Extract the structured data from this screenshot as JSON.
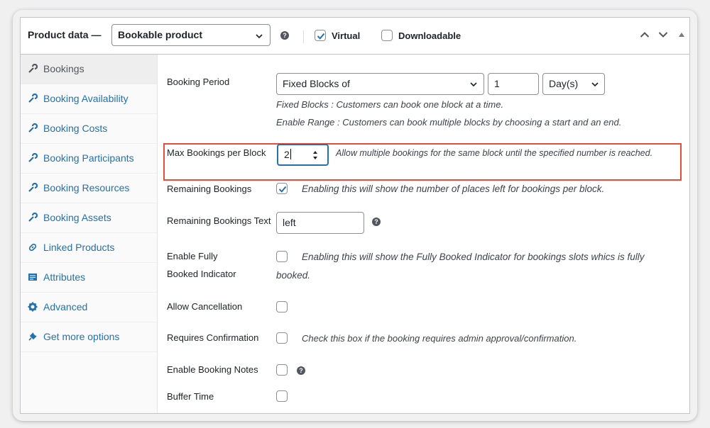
{
  "header": {
    "title": "Product data —",
    "product_type": "Bookable product",
    "virtual_label": "Virtual",
    "virtual_checked": true,
    "downloadable_label": "Downloadable",
    "downloadable_checked": false
  },
  "sidebar": {
    "items": [
      {
        "label": "Bookings",
        "icon": "wrench-icon",
        "active": true
      },
      {
        "label": "Booking Availability",
        "icon": "wrench-icon"
      },
      {
        "label": "Booking Costs",
        "icon": "wrench-icon"
      },
      {
        "label": "Booking Participants",
        "icon": "wrench-icon"
      },
      {
        "label": "Booking Resources",
        "icon": "wrench-icon"
      },
      {
        "label": "Booking Assets",
        "icon": "wrench-icon"
      },
      {
        "label": "Linked Products",
        "icon": "link-icon"
      },
      {
        "label": "Attributes",
        "icon": "list-icon"
      },
      {
        "label": "Advanced",
        "icon": "gear-icon"
      },
      {
        "label": "Get more options",
        "icon": "plugin-icon"
      }
    ]
  },
  "fields": {
    "booking_period": {
      "label": "Booking Period",
      "type_value": "Fixed Blocks of",
      "count_value": "1",
      "unit_value": "Day(s)",
      "desc1": "Fixed Blocks : Customers can book one block at a time.",
      "desc2": "Enable Range : Customers can book multiple blocks by choosing a start and an end."
    },
    "max_bookings": {
      "label": "Max Bookings per Block",
      "value": "2",
      "desc": "Allow multiple bookings for the same block until the specified number is reached."
    },
    "remaining_bookings": {
      "label": "Remaining Bookings",
      "checked": true,
      "desc": "Enabling this will show the number of places left for bookings per block."
    },
    "remaining_bookings_text": {
      "label": "Remaining Bookings Text",
      "value": "left"
    },
    "fully_booked": {
      "label_line1": "Enable Fully",
      "label_line2": "Booked Indicator",
      "desc_line1": "Enabling this will show the Fully Booked Indicator for bookings slots whics is fully",
      "desc_line2": "booked."
    },
    "allow_cancellation": {
      "label": "Allow Cancellation"
    },
    "requires_confirmation": {
      "label": "Requires Confirmation",
      "desc": "Check this box if the booking requires admin approval/confirmation."
    },
    "booking_notes": {
      "label": "Enable Booking Notes"
    },
    "buffer_time": {
      "label": "Buffer Time"
    }
  },
  "colors": {
    "link": "#2271b1",
    "highlight_border": "#e34d3d",
    "focus_border": "#2271b1"
  }
}
